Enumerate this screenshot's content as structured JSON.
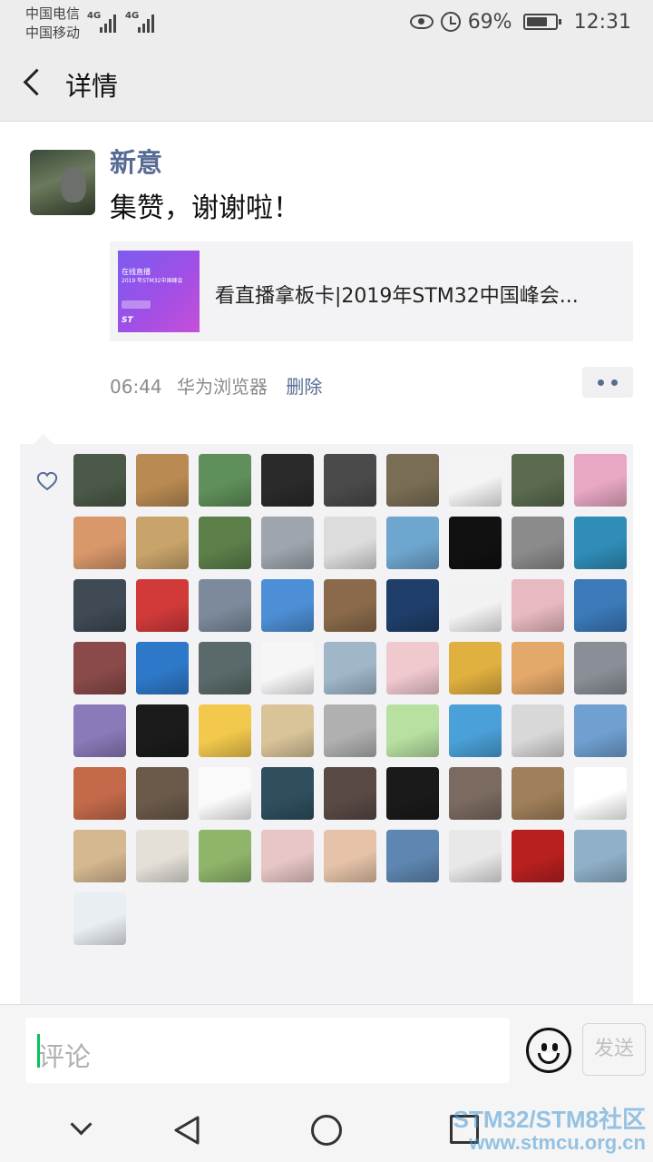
{
  "status_bar": {
    "carrier_1": "中国电信",
    "carrier_2": "中国移动",
    "network_1": "4G",
    "network_2": "4G",
    "battery": "69%",
    "time": "12:31",
    "icons": [
      "eye-comfort-icon",
      "alarm-icon",
      "battery-icon"
    ]
  },
  "nav": {
    "title": "详情"
  },
  "post": {
    "author": "新意",
    "text": "集赞，谢谢啦！",
    "link_card": {
      "title": "看直播拿板卡|2019年STM32中国峰会...",
      "thumb_line_1": "在线直播",
      "thumb_line_2": "2019 年STM32中国峰会",
      "thumb_logo": "ST"
    },
    "time": "06:44",
    "source": "华为浏览器",
    "delete_label": "删除"
  },
  "likes": {
    "count": 64,
    "heart_color": "#576b95",
    "avatars": [
      "#4b5a48",
      "#b98a52",
      "#5f8f5a",
      "#2a2a2a",
      "#4a4a4a",
      "#7a6d55",
      "#f4f4f4",
      "#5a6b4f",
      "#e8a7c3",
      "#d9986a",
      "#c9a46a",
      "#5c7f4a",
      "#9ea5ad",
      "#dcdcdc",
      "#6fa6cf",
      "#111111",
      "#8b8b8b",
      "#2f8db8",
      "#3f4a55",
      "#d23a3a",
      "#7c8a9b",
      "#4d8fd6",
      "#8a6a4a",
      "#1f3f6a",
      "#f2f2f2",
      "#e8b9c0",
      "#3b79b9",
      "#8a4a4a",
      "#2e78c9",
      "#5a6a6a",
      "#f6f6f6",
      "#9fb7c9",
      "#f0c9cf",
      "#e0b040",
      "#e3a86a",
      "#8a8e96",
      "#8a7ab9",
      "#1b1b1b",
      "#f2c94c",
      "#d9c49a",
      "#b0b0b0",
      "#b8e0a0",
      "#4aa0d8",
      "#d8d8d8",
      "#6fa0d0",
      "#c46a4a",
      "#6b5a4a",
      "#fafafa",
      "#2f4f5f",
      "#5a4a45",
      "#1a1a1a",
      "#7a6a60",
      "#a0805a",
      "#ffffff",
      "#d6b890",
      "#e4e0d8",
      "#8fb56a",
      "#e8c6c6",
      "#e5c2a8",
      "#5d87b0",
      "#e8e8e8",
      "#b8201f",
      "#8fb0c8",
      "#e9eef3",
      "#f4f4f4",
      "#6a7a8a",
      "#b9c3cb",
      "#1a1a1a",
      "#4a6a8f",
      "#2a2a2a",
      "#6a3a2a",
      "#ffffff",
      "#6a7a95"
    ]
  },
  "comment": {
    "placeholder": "评论",
    "send_label": "发送"
  },
  "watermark": {
    "line_1": "STM32/STM8社区",
    "line_2": "www.stmcu.org.cn"
  }
}
